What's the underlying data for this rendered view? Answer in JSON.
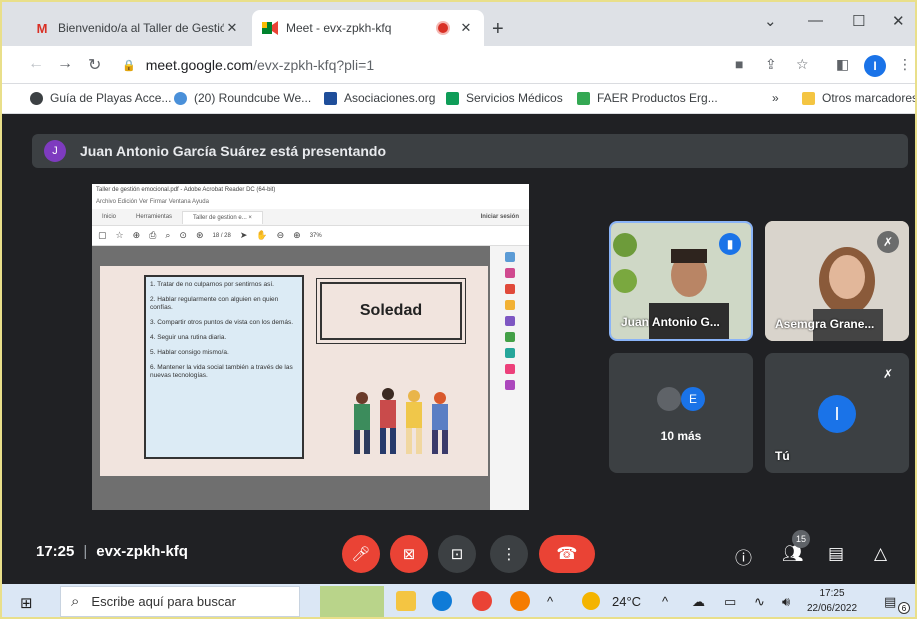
{
  "browser": {
    "tabs": [
      {
        "title": "Bienvenido/a al Taller de Gestión",
        "favicon": "gmail-icon",
        "active": false
      },
      {
        "title": "Meet - evx-zpkh-kfq",
        "favicon": "meet-icon",
        "active": true
      }
    ],
    "new_tab": "+",
    "window_controls": {
      "tabs_menu": "⌄",
      "minimize": "—",
      "maximize": "☐",
      "close": "✕"
    },
    "url_host": "meet.google.com",
    "url_path": "/evx-zpkh-kfq?pli=1",
    "profile_initial": "I",
    "bookmarks": [
      "Guía de Playas Acce...",
      "(20) Roundcube We...",
      "Asociaciones.org",
      "Servicios Médicos",
      "FAER Productos Erg..."
    ],
    "bookmarks_more": "»",
    "other_bookmarks": "Otros marcadores"
  },
  "meet": {
    "presenter_initial": "J",
    "presenter_banner": "Juan Antonio García Suárez está presentando",
    "shared_doc": {
      "window_title": "Taller de gestión emocional.pdf - Adobe Acrobat Reader DC (64-bit)",
      "menu": "Archivo  Edición  Ver  Firmar  Ventana  Ayuda",
      "tabs": [
        "Inicio",
        "Herramientas",
        "Taller de gestion e...  ×"
      ],
      "signin": "Iniciar sesión",
      "zoom": "37%",
      "page_counter": "18 / 28",
      "list_items": [
        "1. Tratar de no culparnos por sentirnos así.",
        "2. Hablar regularmente con alguien en quien confías.",
        "3. Compartir otros puntos de vista con los demás.",
        "4. Seguir una rutina diaria.",
        "5. Hablar consigo mismo/a.",
        "6. Mantener la vida social también a través de las nuevas tecnologías."
      ],
      "slide_title": "Soledad"
    },
    "participants": [
      {
        "name": "Juan Antonio G...",
        "state": "speaking"
      },
      {
        "name": "Asemgra Grane...",
        "state": "muted"
      }
    ],
    "others_label": "10 más",
    "others_avatar_initial": "E",
    "self_initial": "I",
    "self_label": "Tú",
    "time": "17:25",
    "meeting_code": "evx-zpkh-kfq",
    "participant_count": "15",
    "colors": {
      "accent": "#1a73e8",
      "danger": "#ea4335",
      "bg": "#202124",
      "tile": "#3c4043"
    }
  },
  "taskbar": {
    "search_placeholder": "Escribe aquí para buscar",
    "weather": "24°C",
    "time": "17:25",
    "date": "22/06/2022",
    "notifications": "6"
  }
}
